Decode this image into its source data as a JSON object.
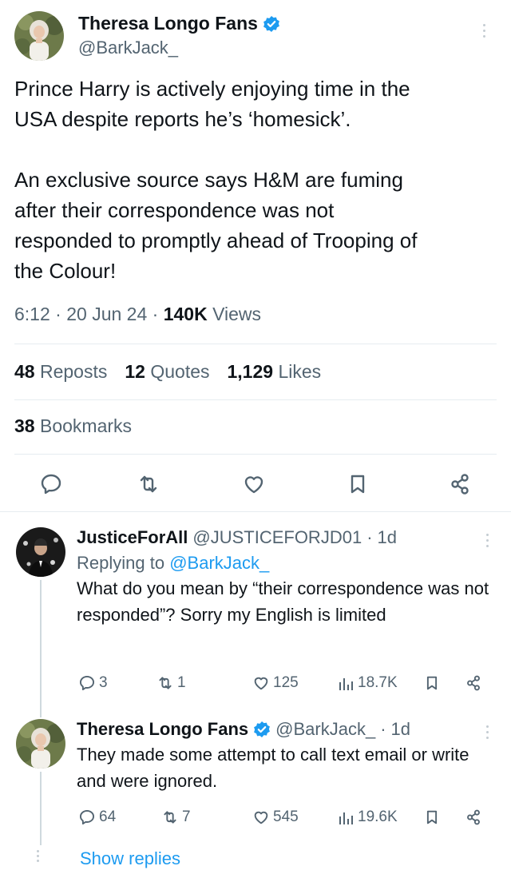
{
  "main_tweet": {
    "display_name": "Theresa Longo Fans",
    "handle": "@BarkJack_",
    "text": "Prince Harry is actively enjoying time in the\nUSA despite reports he’s ‘homesick’.\n\nAn exclusive source says H&M are fuming\nafter their correspondence was not\nresponded to promptly ahead of Trooping of\nthe Colour!",
    "time": "6:12",
    "date": "20 Jun 24",
    "views_count": "140K",
    "views_label": "Views",
    "reposts_count": "48",
    "reposts_label": "Reposts",
    "quotes_count": "12",
    "quotes_label": "Quotes",
    "likes_count": "1,129",
    "likes_label": "Likes",
    "bookmarks_count": "38",
    "bookmarks_label": "Bookmarks"
  },
  "actions": [
    "reply-icon",
    "repost-icon",
    "like-icon",
    "bookmark-icon",
    "share-icon"
  ],
  "replies": [
    {
      "display_name": "JusticeForAll",
      "handle": "@JUSTICEFORJD01",
      "age": "1d",
      "replying_prefix": "Replying to",
      "replying_to": "@BarkJack_",
      "text": "What do you mean by “their correspondence was not responded”? Sorry my English is limited",
      "reply_count": "3",
      "repost_count": "1",
      "like_count": "125",
      "view_count": "18.7K"
    },
    {
      "display_name": "Theresa Longo Fans",
      "handle": "@BarkJack_",
      "age": "1d",
      "text": "They made some attempt to call text email or write and were ignored.",
      "reply_count": "64",
      "repost_count": "7",
      "like_count": "545",
      "view_count": "19.6K"
    }
  ],
  "show_replies": "Show replies",
  "colors": {
    "text": "#0f1419",
    "secondary": "#536471",
    "accent": "#1d9bf0",
    "divider": "#e6ecf0"
  }
}
